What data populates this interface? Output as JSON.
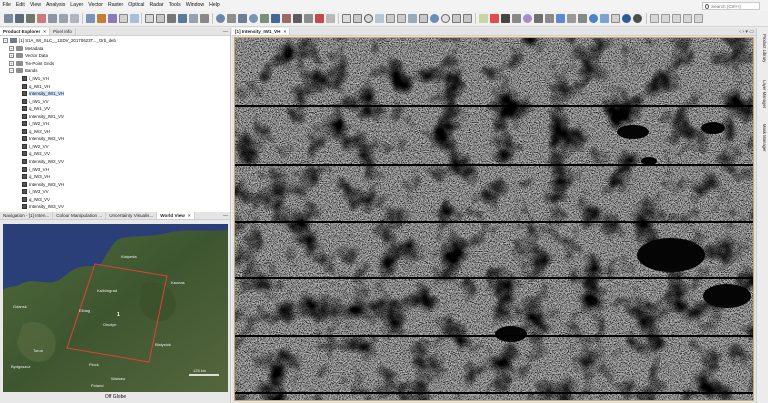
{
  "menu": [
    "File",
    "Edit",
    "View",
    "Analysis",
    "Layer",
    "Vector",
    "Raster",
    "Optical",
    "Radar",
    "Tools",
    "Window",
    "Help"
  ],
  "search": {
    "placeholder": "Search (Ctrl+I)"
  },
  "product_explorer": {
    "tabs": [
      "Product Explorer",
      "Pixel Info"
    ],
    "product_label": "[1] S1A_IW_SLC__1SDV_20170623T..._Orb_deb",
    "folders": [
      "Metadata",
      "Vector Data",
      "Tie-Point Grids",
      "Bands"
    ],
    "bands": [
      "i_IW1_VH",
      "q_IW1_VH",
      "Intensity_IW1_VH",
      "i_IW1_VV",
      "q_IW1_VV",
      "Intensity_IW1_VV",
      "i_IW2_VH",
      "q_IW2_VH",
      "Intensity_IW2_VH",
      "i_IW2_VV",
      "q_IW2_VV",
      "Intensity_IW2_VV",
      "i_IW3_VH",
      "q_IW3_VH",
      "Intensity_IW3_VH",
      "i_IW3_VV",
      "q_IW3_VV",
      "Intensity_IW3_VV"
    ],
    "selected_band": "Intensity_IW1_VH"
  },
  "bottom_panel": {
    "tabs": [
      "Navigation - [1] Inten...",
      "Colour Manipulation ...",
      "Uncertainty Visualis...",
      "World View"
    ],
    "active_tab": "World View",
    "footer": "Off Globe",
    "map_labels": {
      "city_1": "Klaipeda",
      "city_2": "Kaliningrad",
      "city_3": "Kaunas",
      "city_4": "Gdansk",
      "city_5": "Elblag",
      "city_6": "Olsztyn",
      "city_7": "Bialystok",
      "city_8": "Plock",
      "city_9": "Torun",
      "city_10": "Bydgoszcz",
      "city_11": "Warsaw",
      "city_12": "Poland",
      "footprint": "1",
      "scale": "125 km"
    }
  },
  "image_view": {
    "tab": "[1] Intensity_IW1_VH"
  },
  "right_sidebar": [
    "Product Library",
    "Layer Manager",
    "Mask Manager"
  ],
  "colors": {
    "footprint": "#e0403a",
    "image_border": "#c9a96a",
    "selection": "#cfe3ff"
  }
}
